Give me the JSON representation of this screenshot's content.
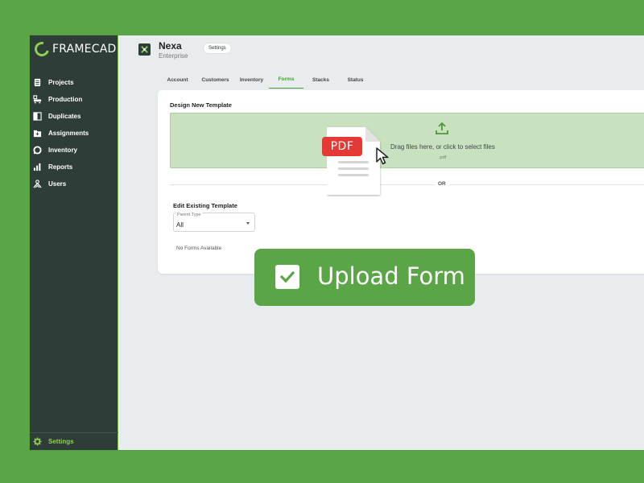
{
  "brand": {
    "logo_text": "FRAMECAD",
    "accent_color": "#8fd14f",
    "sidebar_color": "#2e3d38",
    "background_color": "#5aa646"
  },
  "sidebar": {
    "items": [
      {
        "label": "Projects",
        "icon": "document-icon"
      },
      {
        "label": "Production",
        "icon": "production-icon"
      },
      {
        "label": "Duplicates",
        "icon": "duplicate-icon"
      },
      {
        "label": "Assignments",
        "icon": "folder-add-icon"
      },
      {
        "label": "Inventory",
        "icon": "inventory-icon"
      },
      {
        "label": "Reports",
        "icon": "bar-chart-icon"
      },
      {
        "label": "Users",
        "icon": "users-icon"
      }
    ],
    "settings_label": "Settings"
  },
  "header": {
    "company_name": "Nexa",
    "company_subtitle": "Enterprise",
    "settings_button": "Settings"
  },
  "tabs": [
    {
      "label": "Account",
      "active": false
    },
    {
      "label": "Customers",
      "active": false
    },
    {
      "label": "Inventory",
      "active": false
    },
    {
      "label": "Forms",
      "active": true
    },
    {
      "label": "Stacks",
      "active": false
    },
    {
      "label": "Status",
      "active": false
    }
  ],
  "forms": {
    "design_title": "Design New Template",
    "dropzone_text": "Drag files here, or click to select files",
    "dropzone_ext": ".pdf",
    "or_label": "OR",
    "edit_title": "Edit Existing Template",
    "parent_type_label": "Parent Type",
    "parent_type_value": "All",
    "empty_message": "No Forms Available"
  },
  "overlay": {
    "pdf_badge": "PDF",
    "pdf_badge_color": "#e53935",
    "toast_text": "Upload Form"
  }
}
